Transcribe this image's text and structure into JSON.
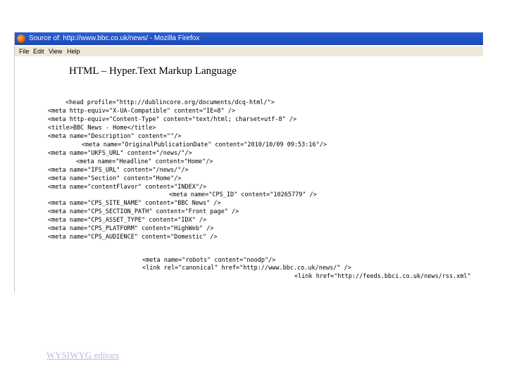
{
  "window": {
    "title": "Source of: http://www.bbc.co.uk/news/ - Mozilla Firefox",
    "menu": [
      "File",
      "Edit",
      "View",
      "Help"
    ]
  },
  "heading": "HTML – Hyper.Text Markup Language",
  "code_lines": [
    "<head profile=\"http://dublincore.org/documents/dcq-html/\">",
    "<meta http-equiv=\"X-UA-Compatible\" content=\"IE=8\" />",
    "<meta http-equiv=\"Content-Type\" content=\"text/html; charset=utf-8\" />",
    "<title>BBC News - Home</title>",
    "<meta name=\"Description\" content=\"\"/>",
    "<meta name=\"OriginalPublicationDate\" content=\"2010/10/09 09:53:16\"/>",
    "<meta name=\"UKFS_URL\" content=\"/news/\"/>",
    "<meta name=\"Headline\" content=\"Home\"/>",
    "<meta name=\"IFS_URL\" content=\"/news/\"/>",
    "<meta name=\"Section\" content=\"Home\"/>",
    "<meta name=\"contentFlavor\" content=\"INDEX\"/>",
    "<meta name=\"CPS_ID\" content=\"10265779\" />",
    "<meta name=\"CPS_SITE_NAME\" content=\"BBC News\" />",
    "<meta name=\"CPS_SECTION_PATH\" content=\"Front page\" />",
    "<meta name=\"CPS_ASSET_TYPE\" content=\"IDX\" />",
    "<meta name=\"CPS_PLATFORM\" content=\"HighWeb\" />",
    "<meta name=\"CPS_AUDIENCE\" content=\"Domestic\" />",
    "<meta name=\"robots\" content=\"noodp\"/>",
    "<link rel=\"canonical\" href=\"http://www.bbc.co.uk/news/\" />",
    "<link href=\"http://feeds.bbci.co.uk/news/rss.xml\""
  ],
  "footer_link": "WYSIWYG editors"
}
